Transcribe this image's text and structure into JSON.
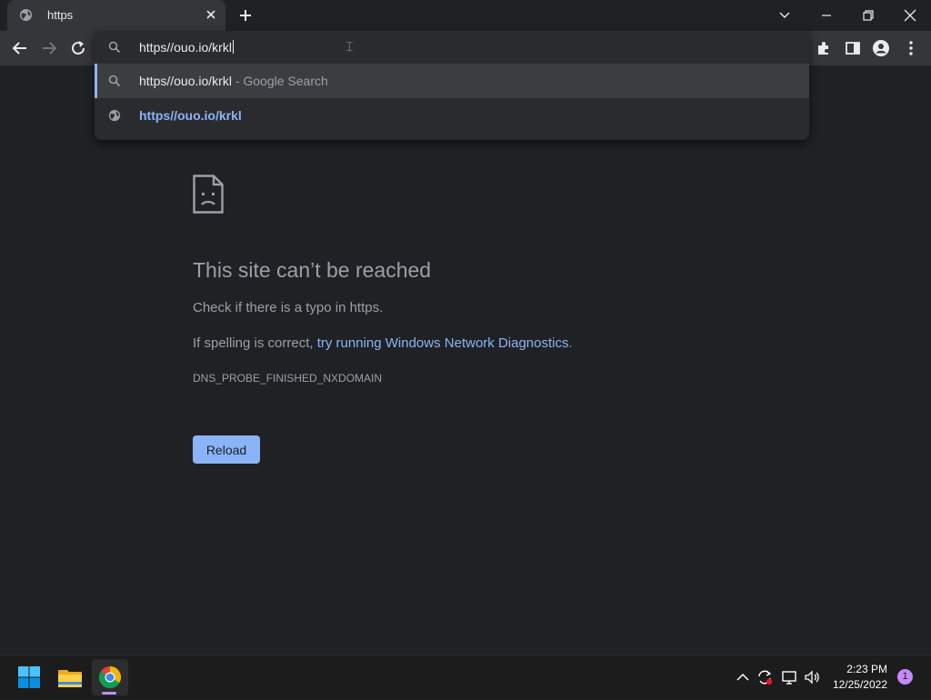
{
  "browser": {
    "tab": {
      "title": "https",
      "icon": "globe-icon"
    },
    "toolbar": {
      "back_icon": "back-arrow-icon",
      "forward_icon": "forward-arrow-icon",
      "reload_icon": "reload-icon"
    },
    "omnibox": {
      "value": "https//ouo.io/krkl",
      "suggestions": [
        {
          "icon": "search-icon",
          "text": "https//ouo.io/krkl",
          "suffix": " - Google Search"
        },
        {
          "icon": "globe-icon",
          "text": "https//ouo.io/krkl"
        }
      ]
    }
  },
  "error_page": {
    "title": "This site can’t be reached",
    "line1": "Check if there is a typo in https.",
    "line2_prefix": "If spelling is correct, ",
    "line2_link": "try running Windows Network Diagnostics",
    "line2_suffix": ".",
    "code": "DNS_PROBE_FINISHED_NXDOMAIN",
    "reload_label": "Reload"
  },
  "taskbar": {
    "apps": [
      "windows-start",
      "file-explorer",
      "chrome"
    ],
    "clock": {
      "time": "2:23 PM",
      "date": "12/25/2022"
    },
    "notification_count": "1"
  },
  "colors": {
    "background": "#202124",
    "toolbar": "#35363a",
    "accent": "#8ab4f8",
    "text_secondary": "#9aa0a6"
  }
}
